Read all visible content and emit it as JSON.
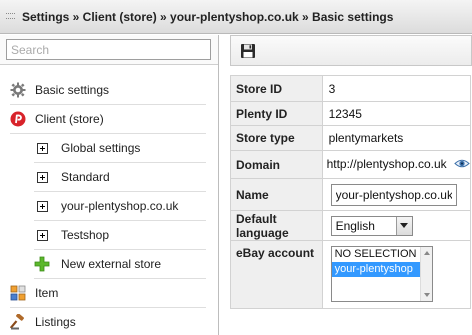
{
  "header": {
    "breadcrumb": "Settings » Client (store) » your-plentyshop.co.uk » Basic settings"
  },
  "sidebar": {
    "search_placeholder": "Search",
    "items": [
      {
        "label": "Basic settings",
        "icon": "gear-icon"
      },
      {
        "label": "Client (store)",
        "icon": "plenty-logo-icon"
      },
      {
        "label": "Global settings",
        "icon": "expand-plus-icon"
      },
      {
        "label": "Standard",
        "icon": "expand-plus-icon"
      },
      {
        "label": "your-plentyshop.co.uk",
        "icon": "expand-plus-icon"
      },
      {
        "label": "Testshop",
        "icon": "expand-plus-icon"
      },
      {
        "label": "New external store",
        "icon": "green-plus-icon"
      },
      {
        "label": "Item",
        "icon": "blocks-icon"
      },
      {
        "label": "Listings",
        "icon": "gavel-icon"
      }
    ]
  },
  "toolbar": {
    "save_icon": "floppy-disk-icon"
  },
  "form": {
    "store_id_label": "Store ID",
    "store_id_value": "3",
    "plenty_id_label": "Plenty ID",
    "plenty_id_value": "12345",
    "store_type_label": "Store type",
    "store_type_value": "plentymarkets",
    "domain_label": "Domain",
    "domain_value": "http://plentyshop.co.uk",
    "name_label": "Name",
    "name_value": "your-plentyshop.co.uk",
    "language_label": "Default language",
    "language_value": "English",
    "ebay_label": "eBay account",
    "ebay_options": [
      "NO SELECTION",
      "your-plentyshop"
    ],
    "ebay_selected": "your-plentyshop"
  },
  "colors": {
    "selection": "#3399ff",
    "label_bg": "#efefef",
    "header_bg": "#dcdcdc"
  }
}
